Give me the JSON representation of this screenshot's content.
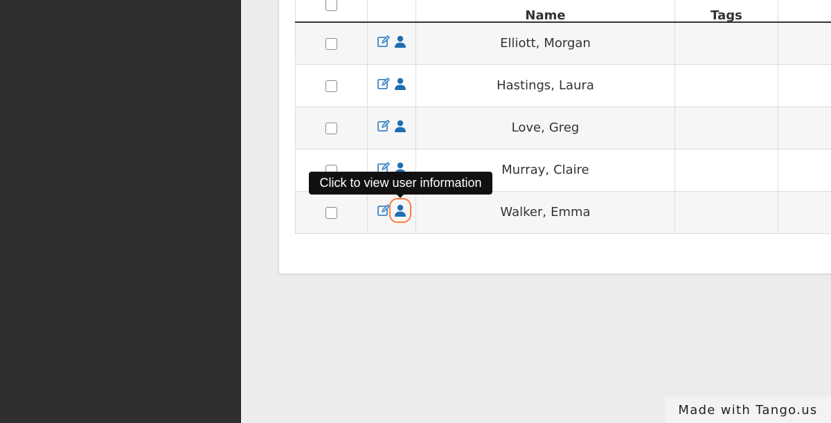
{
  "colors": {
    "sidebar_bg": "#2f2f2f",
    "page_bg": "#ececec",
    "link_blue": "#2b7bbd",
    "highlight_orange": "#ff7a3d",
    "tooltip_bg": "#111111"
  },
  "table": {
    "columns": [
      {
        "key": "select",
        "label": ""
      },
      {
        "key": "actions",
        "label": ""
      },
      {
        "key": "name",
        "label": "Name"
      },
      {
        "key": "tags",
        "label": "Tags"
      },
      {
        "key": "extra",
        "label": ""
      }
    ],
    "rows": [
      {
        "last": "Elliott",
        "sep": ",",
        "first": "Morgan",
        "tags": ""
      },
      {
        "last": "Hastings",
        "sep": ",",
        "first": "Laura",
        "tags": ""
      },
      {
        "last": "Love",
        "sep": ",",
        "first": "Greg",
        "tags": ""
      },
      {
        "last": "Murray",
        "sep": ",",
        "first": "Claire",
        "tags": ""
      },
      {
        "last": "Walker",
        "sep": ",",
        "first": "Emma",
        "tags": ""
      }
    ],
    "icons": {
      "edit": "edit-icon",
      "user": "user-icon"
    }
  },
  "tooltip": {
    "text": "Click to view user information"
  },
  "watermark": {
    "text": "Made with Tango.us"
  }
}
